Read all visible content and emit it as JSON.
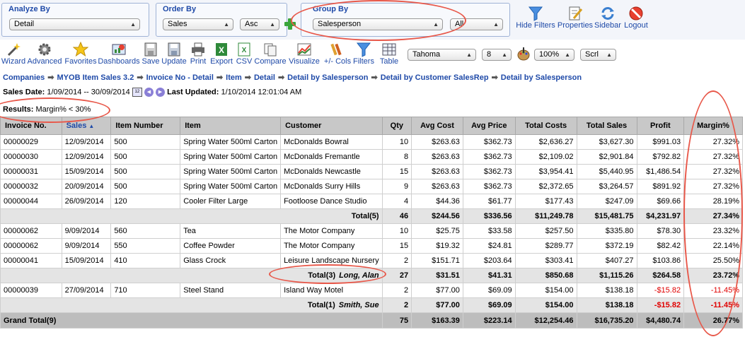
{
  "groups": {
    "analyze": {
      "title": "Analyze By",
      "value": "Detail"
    },
    "order": {
      "title": "Order By",
      "value": "Sales",
      "direction": "Asc"
    },
    "group": {
      "title": "Group By",
      "value": "Salesperson",
      "filter": "All"
    }
  },
  "top_actions": [
    "Hide Filters",
    "Properties",
    "Sidebar",
    "Logout"
  ],
  "toolbar": [
    "Wizard",
    "Advanced",
    "Favorites",
    "Dashboards",
    "Save",
    "Update",
    "Print",
    "Export",
    "CSV",
    "Compare",
    "Visualize",
    "+/- Cols",
    "Filters",
    "Table"
  ],
  "format": {
    "font": "Tahoma",
    "size": "8",
    "zoom": "100%",
    "scroll": "Scrl"
  },
  "breadcrumb": [
    "Companies",
    "MYOB Item Sales 3.2",
    "Invoice No - Detail",
    "Item",
    "Detail",
    "Detail by Salesperson",
    "Detail by Customer SalesRep",
    "Detail by Salesperson"
  ],
  "info": {
    "sales_date_label": "Sales Date:",
    "sales_date_value": "1/09/2014 -- 30/09/2014",
    "updated_label": "Last Updated:",
    "updated_value": "1/10/2014 12:01:04 AM"
  },
  "results": {
    "label": "Results:",
    "value": "Margin% < 30%"
  },
  "columns": [
    "Invoice No.",
    "Sales",
    "Item Number",
    "Item",
    "Customer",
    "Qty",
    "Avg Cost",
    "Avg Price",
    "Total Costs",
    "Total Sales",
    "Profit",
    "Margin%"
  ],
  "rows": [
    {
      "type": "data",
      "cells": [
        "00000029",
        "12/09/2014",
        "500",
        "Spring Water 500ml Carton",
        "McDonalds Bowral",
        "10",
        "$263.63",
        "$362.73",
        "$2,636.27",
        "$3,627.30",
        "$991.03",
        "27.32%"
      ]
    },
    {
      "type": "data",
      "cells": [
        "00000030",
        "12/09/2014",
        "500",
        "Spring Water 500ml Carton",
        "McDonalds Fremantle",
        "8",
        "$263.63",
        "$362.73",
        "$2,109.02",
        "$2,901.84",
        "$792.82",
        "27.32%"
      ]
    },
    {
      "type": "data",
      "cells": [
        "00000031",
        "15/09/2014",
        "500",
        "Spring Water 500ml Carton",
        "McDonalds Newcastle",
        "15",
        "$263.63",
        "$362.73",
        "$3,954.41",
        "$5,440.95",
        "$1,486.54",
        "27.32%"
      ]
    },
    {
      "type": "data",
      "cells": [
        "00000032",
        "20/09/2014",
        "500",
        "Spring Water 500ml Carton",
        "McDonalds Surry Hills",
        "9",
        "$263.63",
        "$362.73",
        "$2,372.65",
        "$3,264.57",
        "$891.92",
        "27.32%"
      ]
    },
    {
      "type": "data",
      "cells": [
        "00000044",
        "26/09/2014",
        "120",
        "Cooler Filter Large",
        "Footloose Dance Studio",
        "4",
        "$44.36",
        "$61.77",
        "$177.43",
        "$247.09",
        "$69.66",
        "28.19%"
      ]
    },
    {
      "type": "total",
      "label": "Total(5)",
      "cells": [
        "46",
        "$244.56",
        "$336.56",
        "$11,249.78",
        "$15,481.75",
        "$4,231.97",
        "27.34%"
      ]
    },
    {
      "type": "data",
      "cells": [
        "00000062",
        "9/09/2014",
        "560",
        "Tea",
        "The Motor Company",
        "10",
        "$25.75",
        "$33.58",
        "$257.50",
        "$335.80",
        "$78.30",
        "23.32%"
      ]
    },
    {
      "type": "data",
      "cells": [
        "00000062",
        "9/09/2014",
        "550",
        "Coffee Powder",
        "The Motor Company",
        "15",
        "$19.32",
        "$24.81",
        "$289.77",
        "$372.19",
        "$82.42",
        "22.14%"
      ]
    },
    {
      "type": "data",
      "cells": [
        "00000041",
        "15/09/2014",
        "410",
        "Glass Crock",
        "Leisure Landscape Nursery",
        "2",
        "$151.71",
        "$203.64",
        "$303.41",
        "$407.27",
        "$103.86",
        "25.50%"
      ]
    },
    {
      "type": "total",
      "label": "Total(3)",
      "person": "Long, Alan",
      "cells": [
        "27",
        "$31.51",
        "$41.31",
        "$850.68",
        "$1,115.26",
        "$264.58",
        "23.72%"
      ]
    },
    {
      "type": "data",
      "neg": true,
      "cells": [
        "00000039",
        "27/09/2014",
        "710",
        "Steel Stand",
        "Island Way Motel",
        "2",
        "$77.00",
        "$69.09",
        "$154.00",
        "$138.18",
        "-$15.82",
        "-11.45%"
      ]
    },
    {
      "type": "total",
      "neg": true,
      "label": "Total(1)",
      "person": "Smith, Sue",
      "cells": [
        "2",
        "$77.00",
        "$69.09",
        "$154.00",
        "$138.18",
        "-$15.82",
        "-11.45%"
      ]
    }
  ],
  "grand_total": {
    "label": "Grand Total(9)",
    "cells": [
      "75",
      "$163.39",
      "$223.14",
      "$12,254.46",
      "$16,735.20",
      "$4,480.74",
      "26.77%"
    ]
  },
  "accent": "#e8584a"
}
